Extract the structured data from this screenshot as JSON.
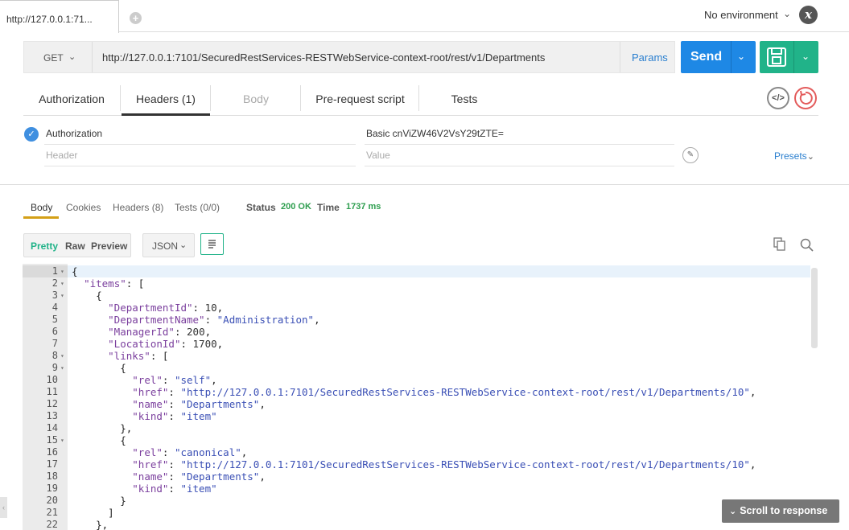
{
  "tabs": {
    "active_label": "http://127.0.0.1:71...",
    "add_symbol": "+"
  },
  "environment": {
    "label": "No environment",
    "logo": "x"
  },
  "request": {
    "method": "GET",
    "url": "http://127.0.0.1:7101/SecuredRestServices-RESTWebService-context-root/rest/v1/Departments",
    "params_label": "Params",
    "send_label": "Send"
  },
  "request_tabs": [
    {
      "label": "Authorization",
      "state": "normal"
    },
    {
      "label": "Headers (1)",
      "state": "active"
    },
    {
      "label": "Body",
      "state": "disabled"
    },
    {
      "label": "Pre-request script",
      "state": "normal"
    },
    {
      "label": "Tests",
      "state": "normal"
    }
  ],
  "headers": {
    "rows": [
      {
        "key": "Authorization",
        "value": "Basic cnViZW46V2VsY29tZTE="
      }
    ],
    "key_placeholder": "Header",
    "value_placeholder": "Value",
    "presets_label": "Presets"
  },
  "response": {
    "tabs": [
      "Body",
      "Cookies",
      "Headers (8)",
      "Tests (0/0)"
    ],
    "status_label": "Status",
    "status_value": "200 OK",
    "time_label": "Time",
    "time_value": "1737 ms",
    "view_modes": [
      "Pretty",
      "Raw",
      "Preview"
    ],
    "format": "JSON",
    "scroll_label": "Scroll to response"
  },
  "code": {
    "line_numbers": [
      "1",
      "2",
      "3",
      "4",
      "5",
      "6",
      "7",
      "8",
      "9",
      "10",
      "11",
      "12",
      "13",
      "14",
      "15",
      "16",
      "17",
      "18",
      "19",
      "20",
      "21",
      "22"
    ],
    "fold_lines": [
      "1",
      "2",
      "3",
      "8",
      "9",
      "15"
    ],
    "lines": [
      [
        [
          "p",
          "{"
        ]
      ],
      [
        [
          "p",
          "  "
        ],
        [
          "k",
          "\"items\""
        ],
        [
          "p",
          ": ["
        ]
      ],
      [
        [
          "p",
          "    {"
        ]
      ],
      [
        [
          "p",
          "      "
        ],
        [
          "k",
          "\"DepartmentId\""
        ],
        [
          "p",
          ": "
        ],
        [
          "n",
          "10"
        ],
        [
          "p",
          ","
        ]
      ],
      [
        [
          "p",
          "      "
        ],
        [
          "k",
          "\"DepartmentName\""
        ],
        [
          "p",
          ": "
        ],
        [
          "s",
          "\"Administration\""
        ],
        [
          "p",
          ","
        ]
      ],
      [
        [
          "p",
          "      "
        ],
        [
          "k",
          "\"ManagerId\""
        ],
        [
          "p",
          ": "
        ],
        [
          "n",
          "200"
        ],
        [
          "p",
          ","
        ]
      ],
      [
        [
          "p",
          "      "
        ],
        [
          "k",
          "\"LocationId\""
        ],
        [
          "p",
          ": "
        ],
        [
          "n",
          "1700"
        ],
        [
          "p",
          ","
        ]
      ],
      [
        [
          "p",
          "      "
        ],
        [
          "k",
          "\"links\""
        ],
        [
          "p",
          ": ["
        ]
      ],
      [
        [
          "p",
          "        {"
        ]
      ],
      [
        [
          "p",
          "          "
        ],
        [
          "k",
          "\"rel\""
        ],
        [
          "p",
          ": "
        ],
        [
          "s",
          "\"self\""
        ],
        [
          "p",
          ","
        ]
      ],
      [
        [
          "p",
          "          "
        ],
        [
          "k",
          "\"href\""
        ],
        [
          "p",
          ": "
        ],
        [
          "s",
          "\"http://127.0.0.1:7101/SecuredRestServices-RESTWebService-context-root/rest/v1/Departments/10\""
        ],
        [
          "p",
          ","
        ]
      ],
      [
        [
          "p",
          "          "
        ],
        [
          "k",
          "\"name\""
        ],
        [
          "p",
          ": "
        ],
        [
          "s",
          "\"Departments\""
        ],
        [
          "p",
          ","
        ]
      ],
      [
        [
          "p",
          "          "
        ],
        [
          "k",
          "\"kind\""
        ],
        [
          "p",
          ": "
        ],
        [
          "s",
          "\"item\""
        ]
      ],
      [
        [
          "p",
          "        },"
        ]
      ],
      [
        [
          "p",
          "        {"
        ]
      ],
      [
        [
          "p",
          "          "
        ],
        [
          "k",
          "\"rel\""
        ],
        [
          "p",
          ": "
        ],
        [
          "s",
          "\"canonical\""
        ],
        [
          "p",
          ","
        ]
      ],
      [
        [
          "p",
          "          "
        ],
        [
          "k",
          "\"href\""
        ],
        [
          "p",
          ": "
        ],
        [
          "s",
          "\"http://127.0.0.1:7101/SecuredRestServices-RESTWebService-context-root/rest/v1/Departments/10\""
        ],
        [
          "p",
          ","
        ]
      ],
      [
        [
          "p",
          "          "
        ],
        [
          "k",
          "\"name\""
        ],
        [
          "p",
          ": "
        ],
        [
          "s",
          "\"Departments\""
        ],
        [
          "p",
          ","
        ]
      ],
      [
        [
          "p",
          "          "
        ],
        [
          "k",
          "\"kind\""
        ],
        [
          "p",
          ": "
        ],
        [
          "s",
          "\"item\""
        ]
      ],
      [
        [
          "p",
          "        }"
        ]
      ],
      [
        [
          "p",
          "      ]"
        ]
      ],
      [
        [
          "p",
          "    },"
        ]
      ]
    ]
  },
  "colors": {
    "send": "#1e88e5",
    "save": "#21b389",
    "status_ok": "#2e9e4f",
    "link": "#2a7fcf"
  }
}
